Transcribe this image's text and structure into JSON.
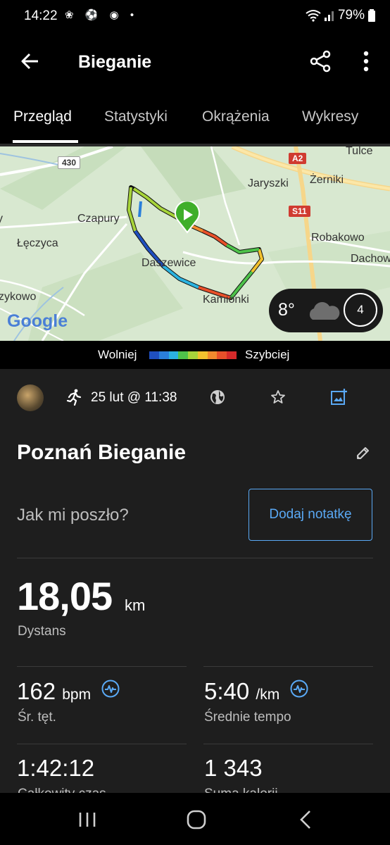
{
  "status_bar": {
    "time": "14:22",
    "left_icons": "❀ ⚽ ◉ •",
    "battery": "79%"
  },
  "app_bar": {
    "title": "Bieganie",
    "back_icon": "arrow-back-icon",
    "share_icon": "share-icon",
    "more_icon": "more-vertical-icon"
  },
  "tabs": [
    {
      "label": "Przegląd",
      "active": true
    },
    {
      "label": "Statystyki",
      "active": false
    },
    {
      "label": "Okrążenia",
      "active": false
    },
    {
      "label": "Wykresy",
      "active": false
    }
  ],
  "map": {
    "labels": {
      "tulce": "Tulce",
      "jaryszki": "Jaryszki",
      "zerniki": "Żerniki",
      "czapury": "Czapury",
      "robakowo": "Robakowo",
      "leczyca": "Łęczyca",
      "daszewice": "Daszewice",
      "dachowa": "Dachow",
      "kamionki": "Kamionki",
      "zykowo": "zykowo",
      "y_label": "y"
    },
    "roads": {
      "r430": "430",
      "a2": "A2",
      "s11": "S11"
    },
    "google_logo": "Google",
    "weather": {
      "temp": "8°",
      "wind": "4",
      "condition_icon": "cloud-icon"
    }
  },
  "legend": {
    "slow": "Wolniej",
    "fast": "Szybciej",
    "colors": [
      "#1f4fbf",
      "#2a7fdb",
      "#2bb3e0",
      "#4ec24a",
      "#a7d43a",
      "#f2c12e",
      "#f28a2e",
      "#e8502a",
      "#d62a2a"
    ]
  },
  "activity": {
    "date": "25 lut @ 11:38",
    "title": "Poznań Bieganie",
    "feel_prompt": "Jak mi poszło?",
    "add_note": "Dodaj notatkę"
  },
  "stats": {
    "distance": {
      "value": "18,05",
      "unit": "km",
      "label": "Dystans"
    },
    "heart_rate": {
      "value": "162",
      "unit": "bpm",
      "label": "Śr. tęt."
    },
    "pace": {
      "value": "5:40",
      "unit": "/km",
      "label": "Średnie tempo"
    },
    "time": {
      "value": "1:42:12",
      "label": "Całkowity czas"
    },
    "calories": {
      "value": "1 343",
      "label": "Suma kalorii"
    }
  },
  "colors": {
    "accent": "#5aa9f5",
    "background": "#1e1e1e",
    "start_marker": "#3fae2a"
  }
}
